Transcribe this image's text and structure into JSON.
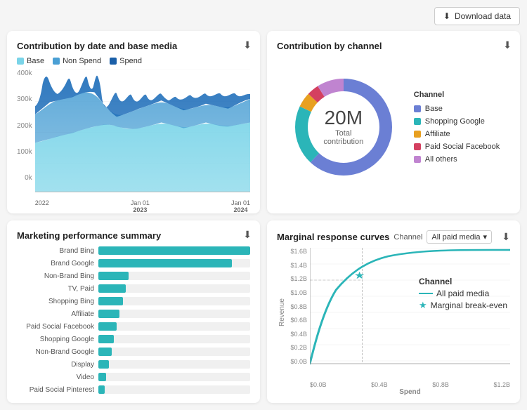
{
  "topbar": {
    "download_label": "Download data"
  },
  "chart1": {
    "title": "Contribution by date and base media",
    "legend": [
      {
        "label": "Base",
        "color": "#7ad4e8"
      },
      {
        "label": "Non Spend",
        "color": "#4a9fd4"
      },
      {
        "label": "Spend",
        "color": "#1a5fa8"
      }
    ],
    "y_axis": [
      "400k",
      "300k",
      "200k",
      "100k",
      "0k"
    ],
    "x_axis": [
      "2022",
      "Jan 01\n2023",
      "Jan 01\n2024"
    ]
  },
  "chart2": {
    "title": "Contribution by channel",
    "donut_value": "20M",
    "donut_label": "Total contribution",
    "channel_legend_title": "Channel",
    "channels": [
      {
        "label": "Base",
        "color": "#6b7fd4",
        "percent": 62
      },
      {
        "label": "Shopping Google",
        "color": "#2bb5b8",
        "percent": 20
      },
      {
        "label": "Affiliate",
        "color": "#e8a020",
        "percent": 5
      },
      {
        "label": "Paid Social Facebook",
        "color": "#d44060",
        "percent": 4
      },
      {
        "label": "All others",
        "color": "#c084d0",
        "percent": 9
      }
    ]
  },
  "chart3": {
    "title": "Marketing performance summary",
    "bars": [
      {
        "label": "Brand Bing",
        "value": 100
      },
      {
        "label": "Brand Google",
        "value": 88
      },
      {
        "label": "Non-Brand Bing",
        "value": 20
      },
      {
        "label": "TV, Paid",
        "value": 18
      },
      {
        "label": "Shopping Bing",
        "value": 16
      },
      {
        "label": "Affiliate",
        "value": 14
      },
      {
        "label": "Paid Social Facebook",
        "value": 12
      },
      {
        "label": "Shopping Google",
        "value": 10
      },
      {
        "label": "Non-Brand Google",
        "value": 9
      },
      {
        "label": "Display",
        "value": 7
      },
      {
        "label": "Video",
        "value": 5
      },
      {
        "label": "Paid Social Pinterest",
        "value": 4
      }
    ]
  },
  "chart4": {
    "title": "Marginal response curves",
    "channel_selector_label": "All paid media",
    "y_axis": [
      "$1.6B",
      "$1.4B",
      "$1.2B",
      "$1.0B",
      "$0.8B",
      "$0.6B",
      "$0.4B",
      "$0.2B",
      "$0.0B"
    ],
    "x_axis": [
      "$0.0B",
      "$0.4B",
      "$0.8B",
      "$1.2B"
    ],
    "x_label": "Spend",
    "y_label": "Revenue",
    "legend_title": "Channel",
    "legend_items": [
      {
        "label": "All paid media",
        "type": "line"
      },
      {
        "label": "Marginal break-even",
        "type": "star"
      }
    ]
  }
}
